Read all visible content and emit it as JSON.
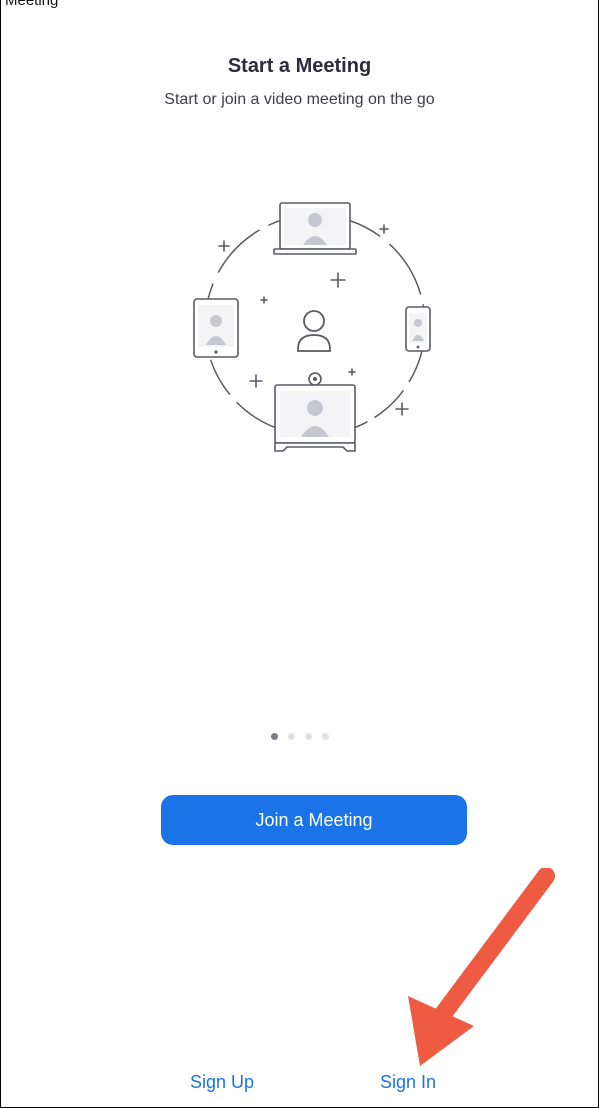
{
  "top_caption": "Meeting",
  "onboarding": {
    "title": "Start a Meeting",
    "subtitle": "Start or join a video meeting on the go"
  },
  "pager": {
    "total": 4,
    "active_index": 0
  },
  "actions": {
    "join_label": "Join a Meeting",
    "sign_up_label": "Sign Up",
    "sign_in_label": "Sign In"
  },
  "colors": {
    "accent": "#1a74e8",
    "annotation_arrow": "#ef5a43"
  },
  "icons": [
    "laptop-icon",
    "tablet-icon",
    "phone-icon",
    "person-icon",
    "conference-display-icon"
  ]
}
